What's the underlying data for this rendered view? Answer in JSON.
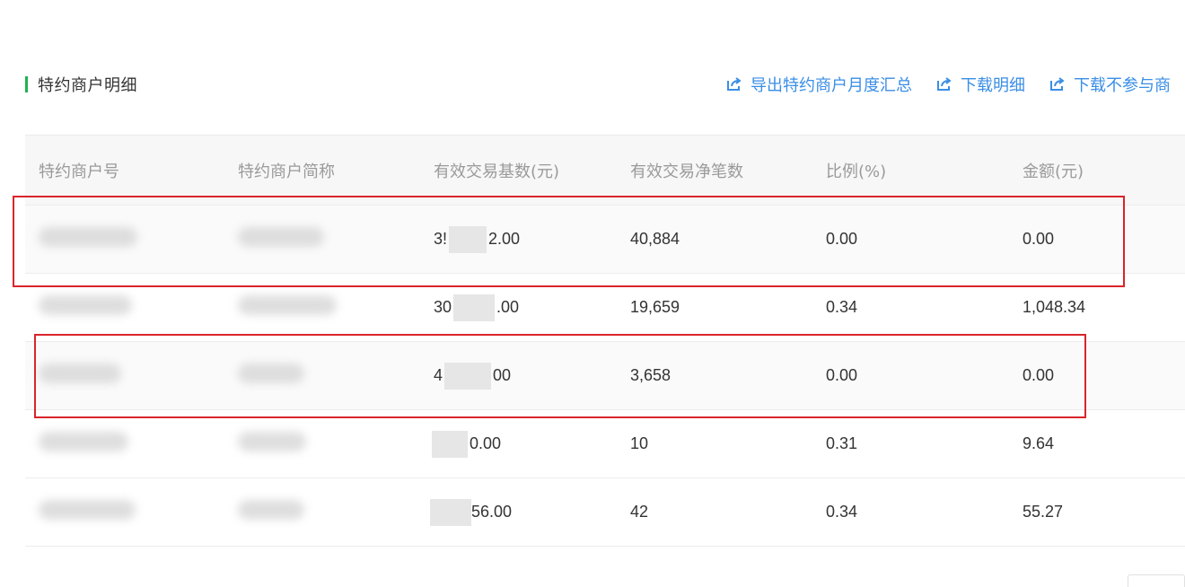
{
  "section": {
    "title": "特约商户明细"
  },
  "actions": [
    {
      "label": "导出特约商户月度汇总",
      "icon": "export-icon"
    },
    {
      "label": "下载明细",
      "icon": "export-icon"
    },
    {
      "label": "下载不参与商",
      "icon": "export-icon"
    }
  ],
  "table": {
    "headers": [
      "特约商户号",
      "特约商户简称",
      "有效交易基数(元)",
      "有效交易净笔数",
      "比例(%)",
      "金额(元)"
    ],
    "rows": [
      {
        "base_prefix": "3!",
        "base_suffix": "2.00",
        "count": "40,884",
        "ratio": "0.00",
        "amount": "0.00"
      },
      {
        "base_prefix": "30",
        "base_suffix": ".00",
        "count": "19,659",
        "ratio": "0.34",
        "amount": "1,048.34"
      },
      {
        "base_prefix": "4",
        "base_suffix": "00",
        "count": "3,658",
        "ratio": "0.00",
        "amount": "0.00"
      },
      {
        "base_prefix": "",
        "base_suffix": "0.00",
        "count": "10",
        "ratio": "0.31",
        "amount": "9.64"
      },
      {
        "base_prefix": "",
        "base_suffix": "56.00",
        "count": "42",
        "ratio": "0.34",
        "amount": "55.27"
      }
    ]
  },
  "colors": {
    "accent": "#3a8ee6",
    "section_bar": "#1fb250",
    "highlight": "#d9252a"
  }
}
